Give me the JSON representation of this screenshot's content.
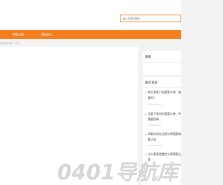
{
  "search": {
    "placeholder": "输入关键词搜索..."
  },
  "nav": {
    "items": [
      {
        "label": "铸铁马桶"
      },
      {
        "label": "创新说法"
      }
    ]
  },
  "breadcrumb": "当前位置:首页 › 正文",
  "sidebar": {
    "search_widget_title": "搜索",
    "recent_widget_title": "最近发表",
    "posts": [
      {
        "title": "每天煮饭只吃蔬菜水果，能瘦吗？",
        "date": "2025-10-22"
      },
      {
        "title": "比爱子爱吃的蔬菜水果，你需要保障",
        "date": "2025-10-22"
      },
      {
        "title": "四氧化铝乳业是水果蔬菜储藏之道",
        "date": "2025-10-22"
      },
      {
        "title": "什么蔬菜是酸性水果蔬菜之蔬",
        "date": "2025-10-22"
      }
    ]
  },
  "watermark": {
    "text": "0401导航库",
    "color": "#cfcfcf"
  },
  "colors": {
    "accent": "#f57e1e"
  }
}
